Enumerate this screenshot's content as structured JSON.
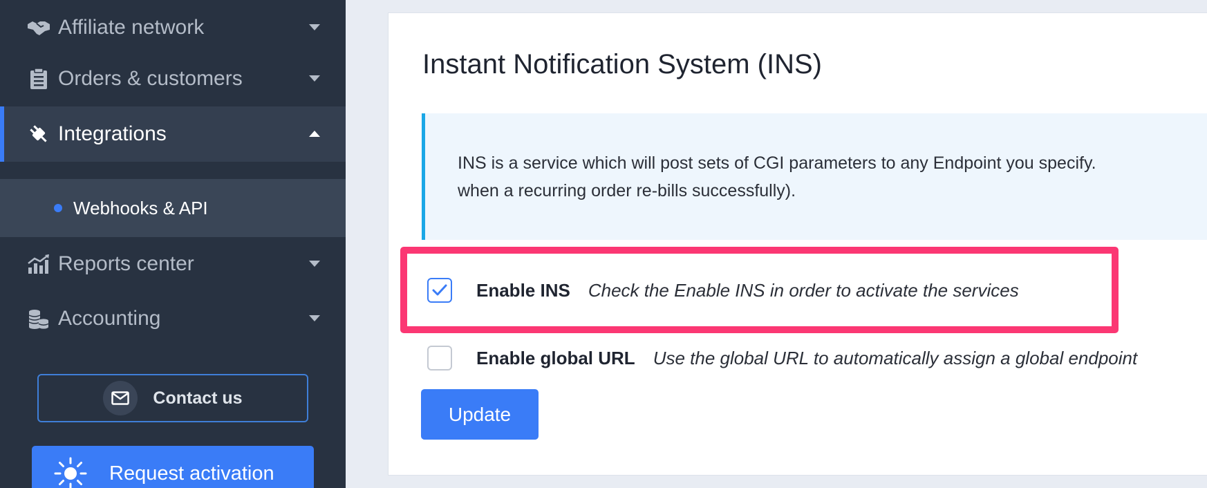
{
  "sidebar": {
    "items": [
      {
        "label": "Affiliate network",
        "icon": "handshake-icon"
      },
      {
        "label": "Orders & customers",
        "icon": "clipboard-icon"
      },
      {
        "label": "Integrations",
        "icon": "plug-icon"
      },
      {
        "label": "Reports center",
        "icon": "chart-icon"
      },
      {
        "label": "Accounting",
        "icon": "coins-icon"
      }
    ],
    "submenu": {
      "label": "Webhooks & API"
    },
    "contact_label": "Contact us",
    "activation_label": "Request activation"
  },
  "main": {
    "title": "Instant Notification System (INS)",
    "info_line1": "INS is a service which will post sets of CGI parameters to any Endpoint you specify.",
    "info_line2": "when a recurring order re-bills successfully).",
    "enable_ins": {
      "label": "Enable INS",
      "help": "Check the Enable INS in order to activate the services",
      "checked": true
    },
    "enable_global_url": {
      "label": "Enable global URL",
      "help": "Use the global URL to automatically assign a global endpoint",
      "checked": false
    },
    "update_label": "Update"
  },
  "colors": {
    "sidebar_bg": "#283241",
    "accent": "#3a7cf7",
    "highlight": "#fb3773",
    "info_border": "#1aa7e6"
  }
}
